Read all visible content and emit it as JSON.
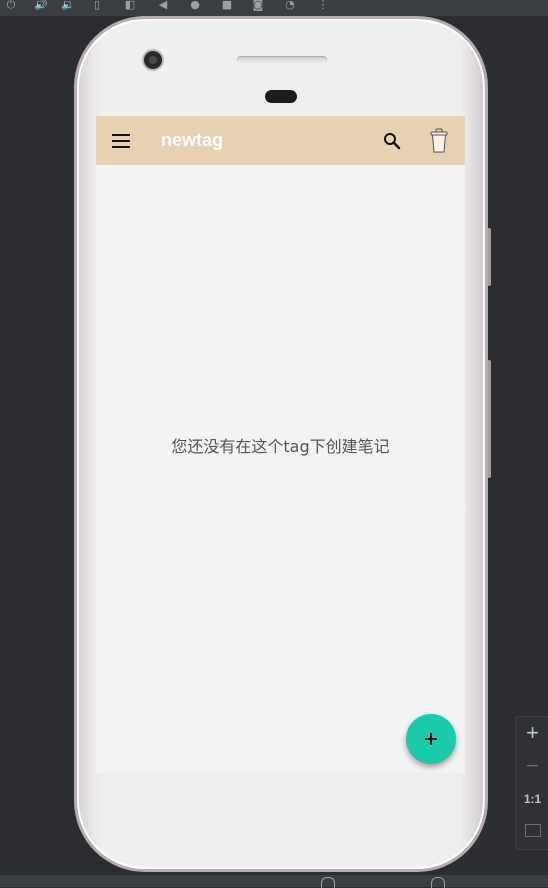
{
  "app": {
    "title": "newtag",
    "empty_message": "您还没有在这个tag下创建笔记"
  },
  "zoom_panel": {
    "zoom_in_label": "+",
    "zoom_out_label": "−",
    "actual_size_label": "1:1"
  },
  "icons": {
    "menu": "hamburger-menu-icon",
    "search": "search-icon",
    "trash": "trash-can-icon",
    "add": "add-icon"
  },
  "colors": {
    "app_bar": "#e8d1b0",
    "fab": "#1bcaa8",
    "screen_background": "#f3f3f3",
    "ide_background": "#2b2d30"
  }
}
